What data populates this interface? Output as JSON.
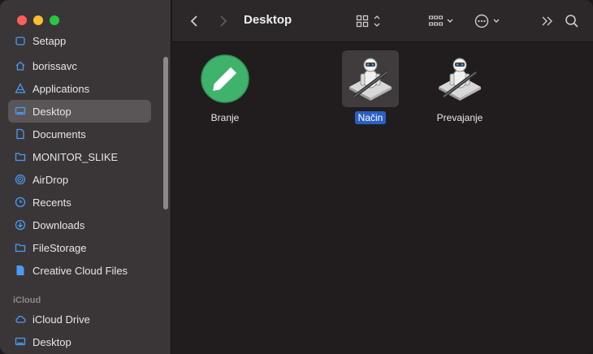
{
  "window": {
    "title": "Desktop"
  },
  "sidebar": {
    "items": [
      {
        "label": "Setapp",
        "icon": "app-icon"
      },
      {
        "label": "borissavc",
        "icon": "home-icon"
      },
      {
        "label": "Applications",
        "icon": "applications-icon"
      },
      {
        "label": "Desktop",
        "icon": "desktop-icon",
        "selected": true
      },
      {
        "label": "Documents",
        "icon": "document-icon"
      },
      {
        "label": "MONITOR_SLIKE",
        "icon": "folder-icon"
      },
      {
        "label": "AirDrop",
        "icon": "airdrop-icon"
      },
      {
        "label": "Recents",
        "icon": "clock-icon"
      },
      {
        "label": "Downloads",
        "icon": "download-icon"
      },
      {
        "label": "FileStorage",
        "icon": "folder-icon"
      },
      {
        "label": "Creative Cloud Files",
        "icon": "file-icon"
      }
    ],
    "section_icloud": "iCloud",
    "icloud_items": [
      {
        "label": "iCloud Drive",
        "icon": "cloud-icon"
      },
      {
        "label": "Desktop",
        "icon": "desktop-icon"
      }
    ]
  },
  "files": [
    {
      "name": "Branje",
      "icon": "pencil-app-icon",
      "selected": false
    },
    {
      "name": "Način",
      "icon": "automator-icon",
      "selected": true
    },
    {
      "name": "Prevajanje",
      "icon": "automator-icon",
      "selected": false
    }
  ],
  "colors": {
    "selection": "#2c5fc5",
    "sidebar_bg": "#3a3637",
    "content_bg": "#211d1e"
  }
}
